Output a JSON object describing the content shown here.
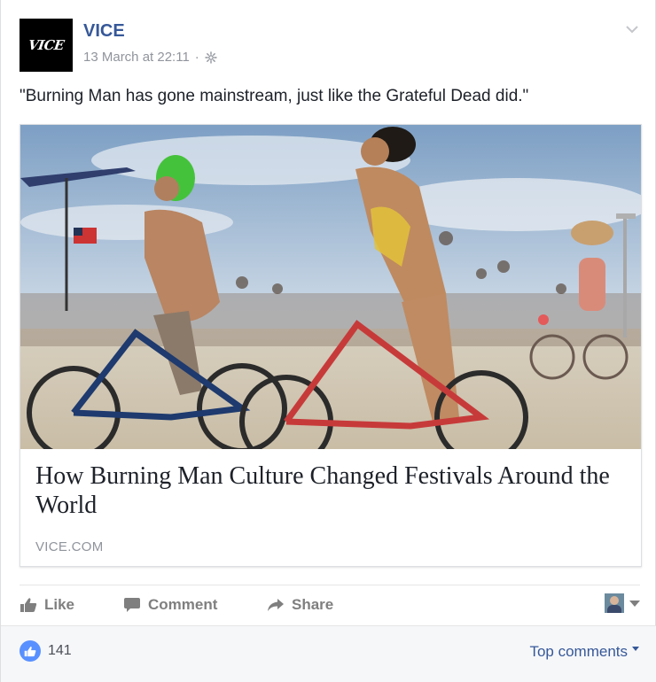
{
  "post": {
    "page_name": "VICE",
    "avatar_text": "VICE",
    "timestamp": "13 March at 22:11",
    "separator": "·",
    "text": "\"Burning Man has gone mainstream, just like the Grateful Dead did.\""
  },
  "link": {
    "title": "How Burning Man Culture Changed Festivals Around the World",
    "domain": "VICE.COM"
  },
  "actions": {
    "like": "Like",
    "comment": "Comment",
    "share": "Share"
  },
  "footer": {
    "like_count": "141",
    "top_comments": "Top comments"
  },
  "colors": {
    "link_blue": "#365899",
    "like_badge": "#5890ff",
    "muted": "#90949c"
  }
}
